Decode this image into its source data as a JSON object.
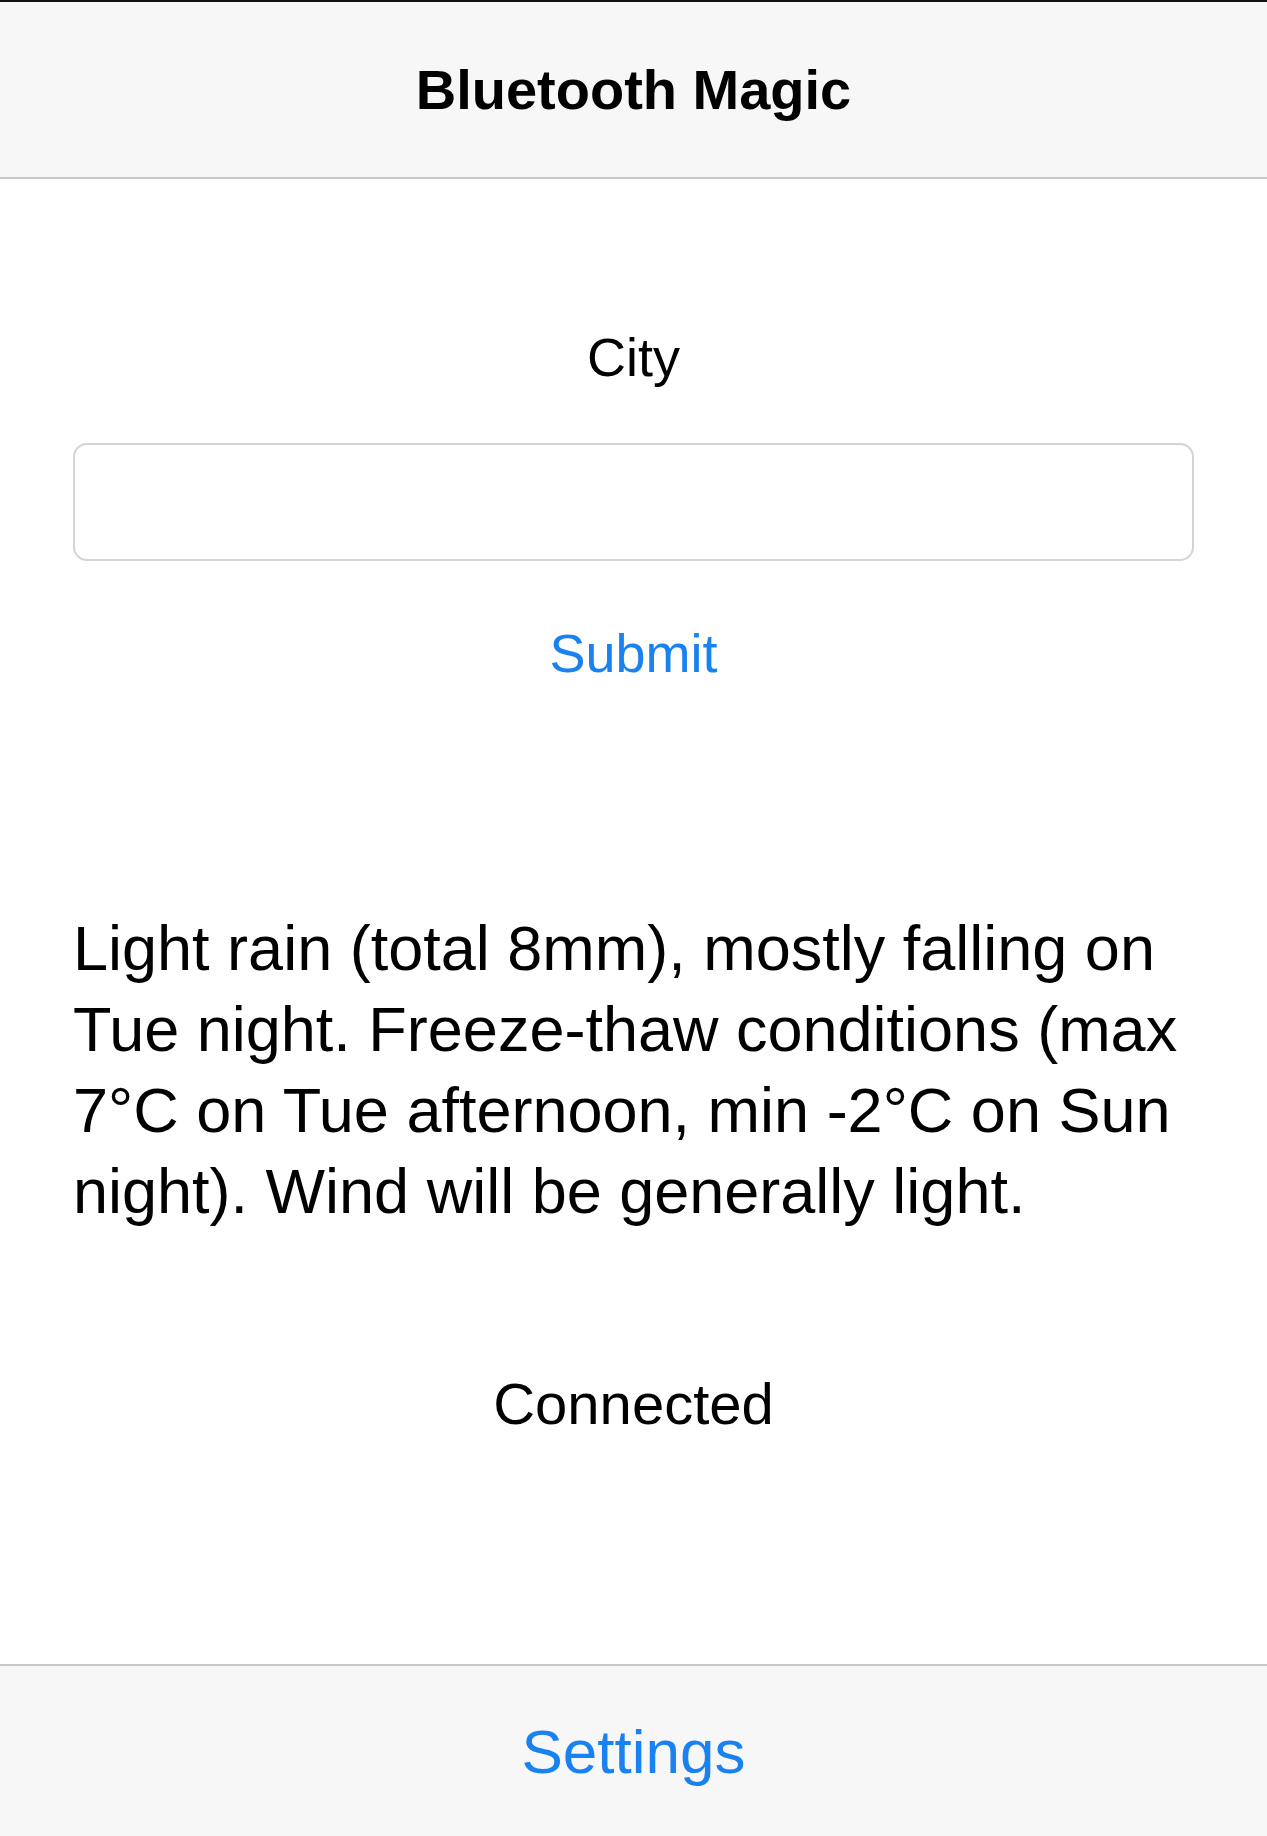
{
  "nav_bar": {
    "title": "Bluetooth Magic"
  },
  "form": {
    "label": "City",
    "submit": "Submit"
  },
  "forecast": "Light rain (total 8mm), mostly falling on Tue night. Freeze-thaw conditions (max 7°C on Tue afternoon, min -2°C on Sun night). Wind will be generally light.",
  "status": "Connected",
  "tab_bar": {
    "items": [
      {
        "label": "Settings"
      }
    ]
  }
}
